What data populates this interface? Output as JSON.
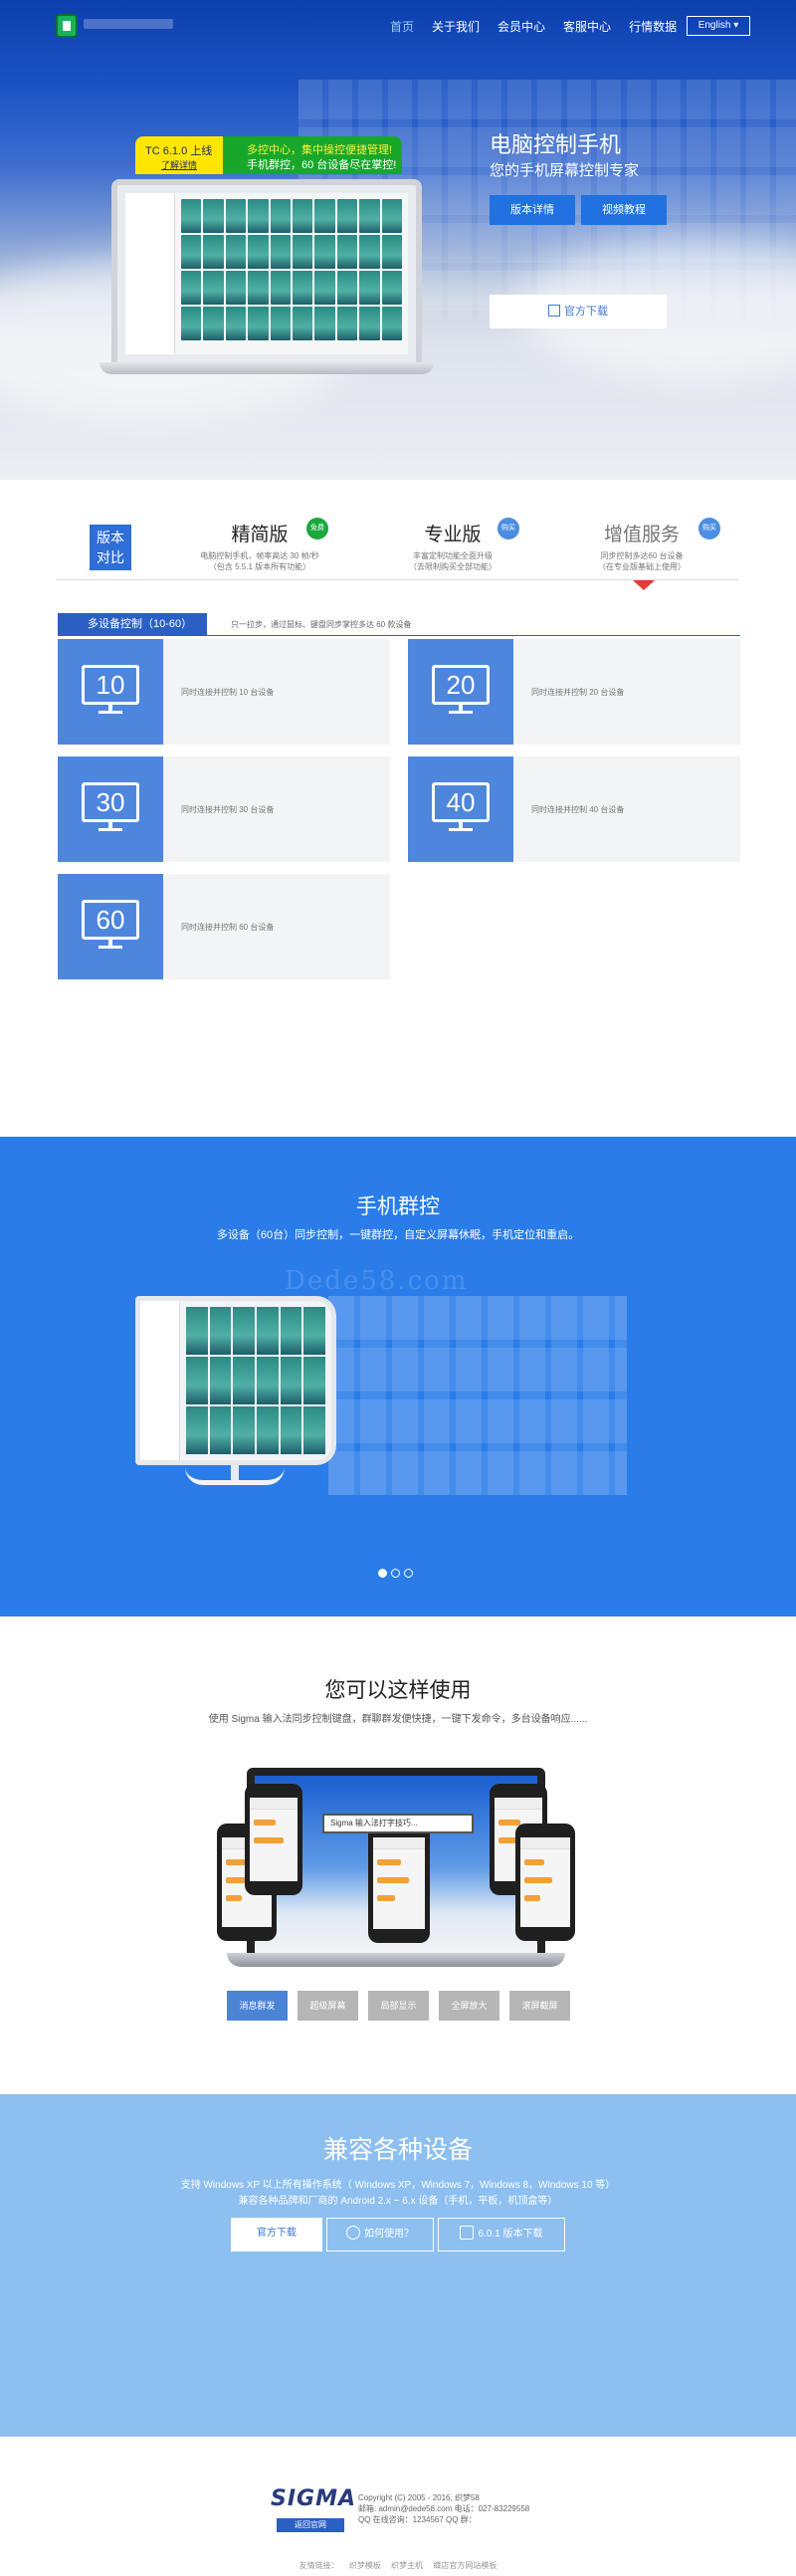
{
  "nav": {
    "items": [
      "首页",
      "关于我们",
      "会员中心",
      "客服中心",
      "行情数据"
    ],
    "language": "English ▾"
  },
  "hero": {
    "tag_version": "TC 6.1.0 上线",
    "tag_detail": "了解详情",
    "tag_line1": "多控中心，集中操控便捷管理!",
    "tag_line2": "手机群控，60 台设备尽在掌控!",
    "title": "电脑控制手机",
    "subtitle": "您的手机屏幕控制专家",
    "btn_version": "版本详情",
    "btn_video": "视频教程",
    "btn_download": "官方下载"
  },
  "versions": {
    "badge": "版本\n对比",
    "cols": [
      {
        "name": "精简版",
        "tag": "免费",
        "desc1": "电脑控制手机，帧率高达 30 帧/秒",
        "desc2": "（包含 5.5.1 版本所有功能）"
      },
      {
        "name": "专业版",
        "tag": "购买",
        "desc1": "丰富定制功能全面升级",
        "desc2": "（去限制购买全部功能）"
      },
      {
        "name": "增值服务",
        "tag": "购买",
        "desc1": "同步控制多达60 台设备",
        "desc2": "（在专业版基础上使用）"
      }
    ],
    "tab_label": "多设备控制（10-60）",
    "tab_note": "只一拉步，通过鼠标、键盘同步掌控多达 60 款设备",
    "cards": [
      {
        "num": "10",
        "text": "同时连接并控制 10 台设备"
      },
      {
        "num": "20",
        "text": "同时连接并控制 20 台设备"
      },
      {
        "num": "30",
        "text": "同时连接并控制 30 台设备"
      },
      {
        "num": "40",
        "text": "同时连接并控制 40 台设备"
      },
      {
        "num": "60",
        "text": "同时连接并控制 60 台设备"
      }
    ]
  },
  "group": {
    "title": "手机群控",
    "subtitle": "多设备（60台）同步控制，一键群控，自定义屏幕休眠，手机定位和重启。",
    "watermark": "Dede58.com"
  },
  "usage": {
    "title": "您可以这样使用",
    "subtitle": "使用 Sigma 输入法同步控制键盘，群聊群发便快捷，一键下发命令，多台设备响应......",
    "input_bar": "Sigma 输入法打字技巧...",
    "tabs": [
      "消息群发",
      "超级屏幕",
      "局部显示",
      "全屏放大",
      "滚屏截屏"
    ]
  },
  "compat": {
    "title": "兼容各种设备",
    "line1": "支持 Windows XP 以上所有操作系统（ Windows XP，Windows 7，Windows 8，Windows 10 等）",
    "line2": "兼容各种品牌和厂商的 Android 2.x ~ 6.x 设备（手机，平板，机顶盒等）",
    "btn_download": "官方下载",
    "btn_howto": "如何使用？",
    "btn_old": "6.0.1 版本下载"
  },
  "footer": {
    "logo_text": "SIGMA",
    "logo_sub": "返回官网",
    "copyright": "Copyright (C) 2005 - 2016, 织梦58",
    "email": "邮箱: admin@dede58.com 电话：027-83229558",
    "qq": "QQ 在线咨询：1234567 QQ 群：",
    "links": [
      "友情链接：",
      "织梦模板",
      "织梦主机",
      "織店官方网站模板"
    ]
  }
}
